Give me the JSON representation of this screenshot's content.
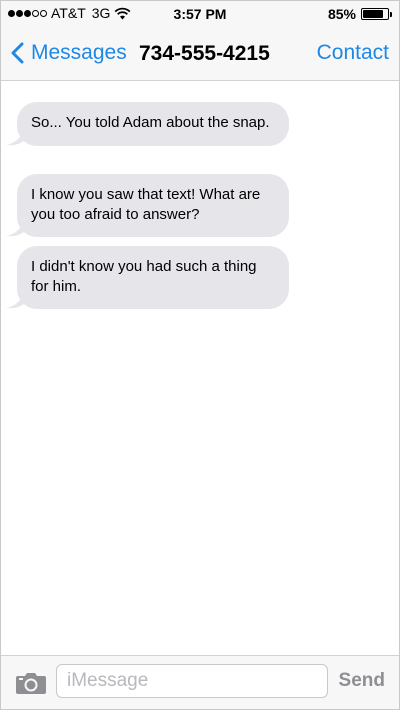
{
  "status_bar": {
    "carrier": "AT&T",
    "network": "3G",
    "time": "3:57 PM",
    "battery_percent": "85%",
    "battery_level": 0.85,
    "signal_bars": 3,
    "signal_total": 5
  },
  "nav": {
    "back_label": "Messages",
    "title": "734-555-4215",
    "contact_label": "Contact",
    "accent_color": "#1e88e5"
  },
  "messages": [
    {
      "text": "So... You told Adam about the snap.",
      "direction": "incoming"
    },
    {
      "text": "I know you saw that text! What are you too afraid to answer?",
      "direction": "incoming"
    },
    {
      "text": "I didn't know you had such a thing for him.",
      "direction": "incoming"
    }
  ],
  "composer": {
    "camera_icon": "camera-icon",
    "placeholder": "iMessage",
    "value": "",
    "send_label": "Send"
  },
  "colors": {
    "incoming_bubble": "#e5e5ea",
    "bar_background": "#f7f7f8"
  }
}
